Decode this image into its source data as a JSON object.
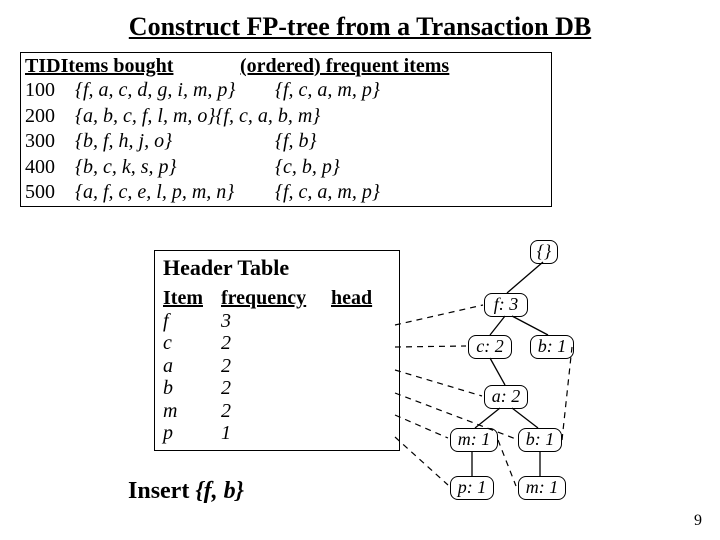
{
  "title": "Construct FP-tree from a Transaction DB",
  "table": {
    "head_tid_items": "TIDItems bought",
    "head_freq": "(ordered) frequent items",
    "rows": [
      {
        "tid": "100",
        "items": "{f, a, c, d, g, i, m, p}",
        "freq": "{f, c, a, m, p}"
      },
      {
        "tid": "200",
        "items": "{a, b, c, f, l, m, o}{f, c, a, b, m}",
        "freq": ""
      },
      {
        "tid": "300",
        "items": "{b, f, h, j, o}",
        "freq": "{f, b}"
      },
      {
        "tid": "400",
        "items": "{b, c, k, s, p}",
        "freq": "{c, b, p}"
      },
      {
        "tid": "500",
        "items": "{a, f, c, e, l, p, m, n}",
        "freq": "{f, c, a, m, p}"
      }
    ]
  },
  "header_table": {
    "title": "Header Table",
    "head_item": "Item",
    "head_freq": "frequency",
    "head_head": "head",
    "rows": [
      {
        "item": "f",
        "freq": "3"
      },
      {
        "item": "c",
        "freq": "2"
      },
      {
        "item": "a",
        "freq": "2"
      },
      {
        "item": "b",
        "freq": "2"
      },
      {
        "item": "m",
        "freq": "2"
      },
      {
        "item": "p",
        "freq": "1"
      }
    ]
  },
  "insert_label": "Insert ",
  "insert_set": "{f, b}",
  "tree": {
    "root": "{}",
    "f3": "f: 3",
    "c2": "c: 2",
    "b1top": "b: 1",
    "a2": "a: 2",
    "m1": "m: 1",
    "b1bot": "b: 1",
    "p1": "p: 1",
    "m1bot": "m: 1"
  },
  "page": "9",
  "chart_data": {
    "type": "table",
    "title": "FP-tree construction after inserting {f, b}",
    "transaction_db": [
      {
        "tid": 100,
        "items_bought": [
          "f",
          "a",
          "c",
          "d",
          "g",
          "i",
          "m",
          "p"
        ],
        "ordered_frequent": [
          "f",
          "c",
          "a",
          "m",
          "p"
        ]
      },
      {
        "tid": 200,
        "items_bought": [
          "a",
          "b",
          "c",
          "f",
          "l",
          "m",
          "o"
        ],
        "ordered_frequent": [
          "f",
          "c",
          "a",
          "b",
          "m"
        ]
      },
      {
        "tid": 300,
        "items_bought": [
          "b",
          "f",
          "h",
          "j",
          "o"
        ],
        "ordered_frequent": [
          "f",
          "b"
        ]
      },
      {
        "tid": 400,
        "items_bought": [
          "b",
          "c",
          "k",
          "s",
          "p"
        ],
        "ordered_frequent": [
          "c",
          "b",
          "p"
        ]
      },
      {
        "tid": 500,
        "items_bought": [
          "a",
          "f",
          "c",
          "e",
          "l",
          "p",
          "m",
          "n"
        ],
        "ordered_frequent": [
          "f",
          "c",
          "a",
          "m",
          "p"
        ]
      }
    ],
    "header_table": [
      {
        "item": "f",
        "frequency": 3
      },
      {
        "item": "c",
        "frequency": 2
      },
      {
        "item": "a",
        "frequency": 2
      },
      {
        "item": "b",
        "frequency": 2
      },
      {
        "item": "m",
        "frequency": 2
      },
      {
        "item": "p",
        "frequency": 1
      }
    ],
    "fp_tree": {
      "root": "{}",
      "children": [
        {
          "item": "f",
          "count": 3,
          "children": [
            {
              "item": "c",
              "count": 2,
              "children": [
                {
                  "item": "a",
                  "count": 2,
                  "children": [
                    {
                      "item": "m",
                      "count": 1,
                      "children": [
                        {
                          "item": "p",
                          "count": 1,
                          "children": []
                        }
                      ]
                    },
                    {
                      "item": "b",
                      "count": 1,
                      "children": [
                        {
                          "item": "m",
                          "count": 1,
                          "children": []
                        }
                      ]
                    }
                  ]
                }
              ]
            },
            {
              "item": "b",
              "count": 1,
              "children": []
            }
          ]
        }
      ]
    },
    "node_links": {
      "f": [
        "root/f"
      ],
      "c": [
        "root/f/c"
      ],
      "a": [
        "root/f/c/a"
      ],
      "b": [
        "root/f/c/a/b",
        "root/f/b"
      ],
      "m": [
        "root/f/c/a/m",
        "root/f/c/a/b/m"
      ],
      "p": [
        "root/f/c/a/m/p"
      ]
    }
  }
}
